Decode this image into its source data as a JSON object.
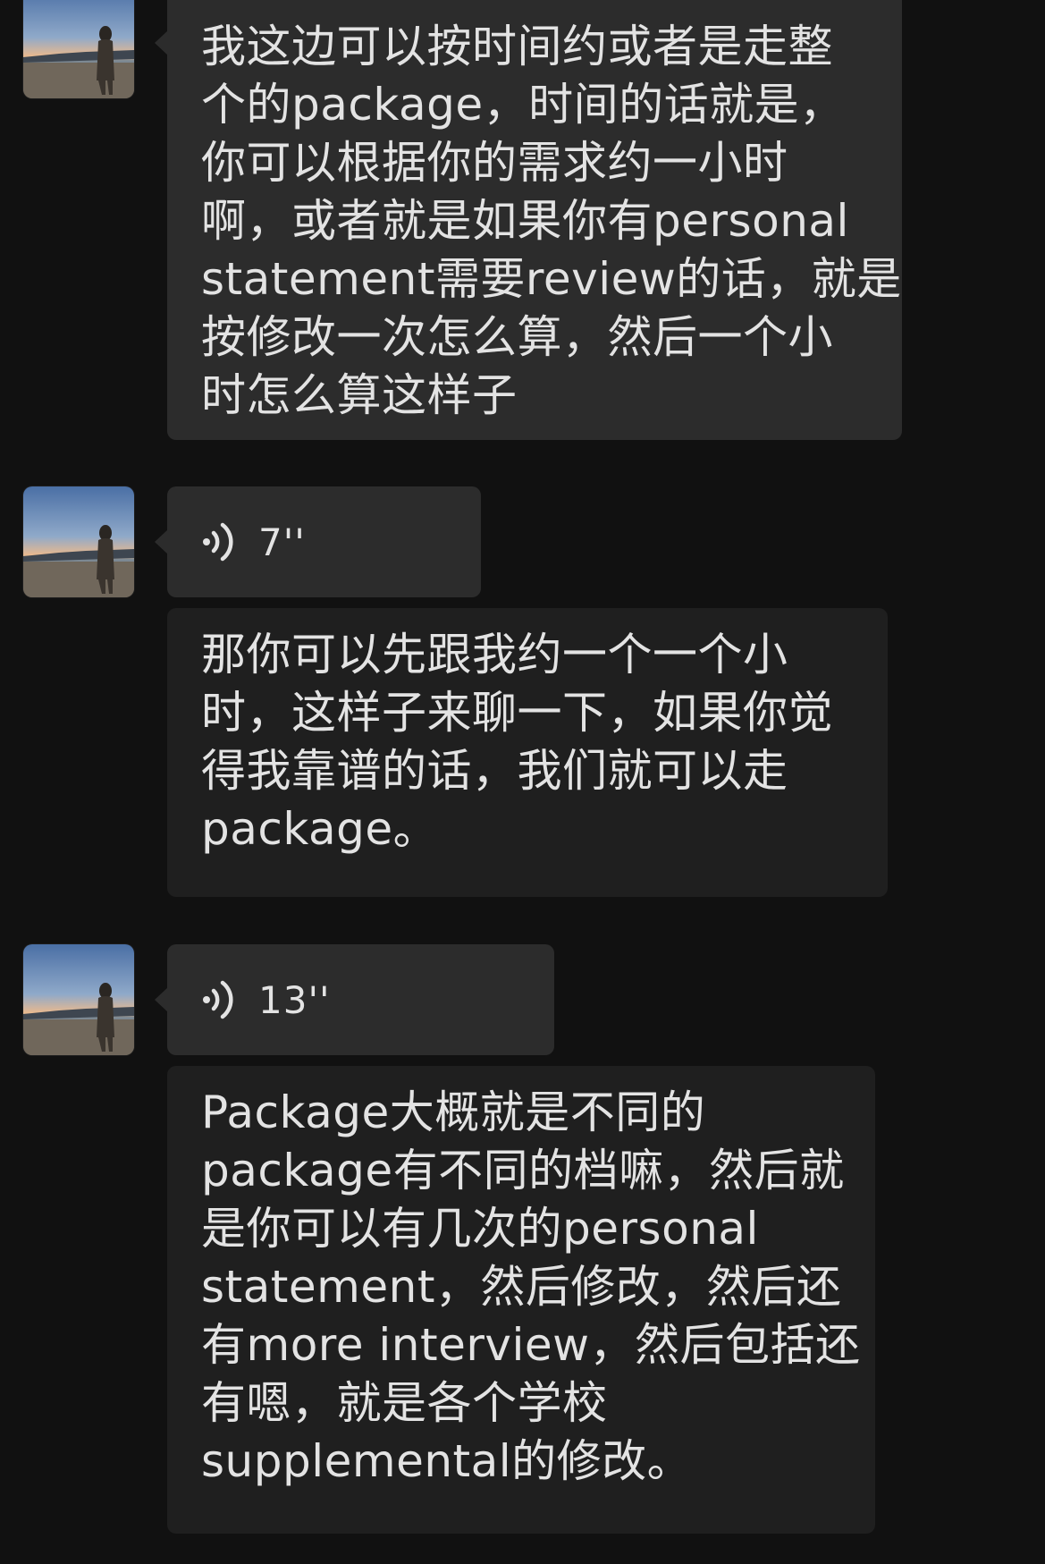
{
  "messages": [
    {
      "type": "text",
      "lines": [
        "我这边可以按时间约或者是走整",
        "个的package，时间的话就是，",
        "你可以根据你的需求约一小时",
        "啊，或者就是如果你有personal",
        "statement需要review的话，就是",
        "按修改一次怎么算，然后一个小",
        "时怎么算这样子"
      ]
    },
    {
      "type": "voice",
      "duration": "7''",
      "icon": "voice-wave-icon"
    },
    {
      "type": "text",
      "lines": [
        "那你可以先跟我约一个一个小",
        "时，这样子来聊一下，如果你觉",
        "得我靠谱的话，我们就可以走",
        "package。"
      ]
    },
    {
      "type": "voice",
      "duration": "13''",
      "icon": "voice-wave-icon"
    },
    {
      "type": "text",
      "lines": [
        "Package大概就是不同的",
        "package有不同的档嘛，然后就",
        "是你可以有几次的personal",
        "statement，然后修改，然后还",
        "有more interview，然后包括还",
        "有嗯，就是各个学校",
        "supplemental的修改。"
      ]
    }
  ],
  "colors": {
    "background": "#111111",
    "bubble": "#2c2c2c",
    "bubble_dark": "#1f1f1f",
    "text": "#e3e3e3"
  }
}
